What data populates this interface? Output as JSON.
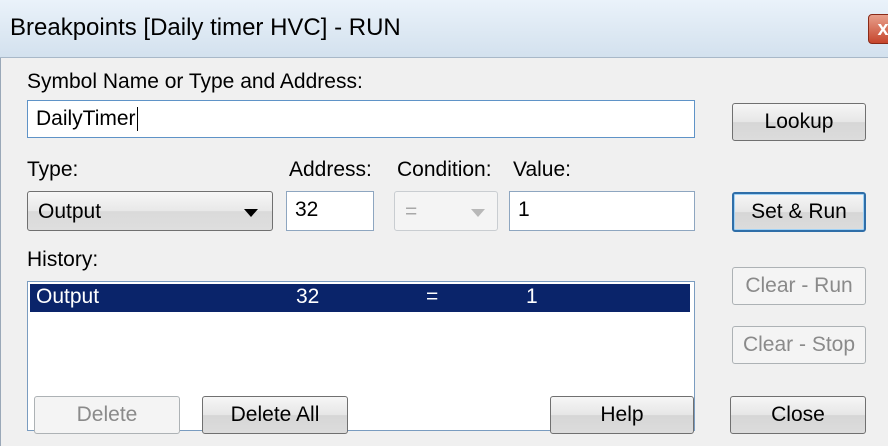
{
  "window": {
    "title": "Breakpoints [Daily timer HVC] - RUN",
    "close_glyph": "x"
  },
  "symbol": {
    "label": "Symbol Name or Type and Address:",
    "value": "DailyTimer"
  },
  "fields": {
    "type_label": "Type:",
    "type_value": "Output",
    "address_label": "Address:",
    "address_value": "32",
    "condition_label": "Condition:",
    "condition_value": "=",
    "value_label": "Value:",
    "value_value": "1"
  },
  "history": {
    "label": "History:",
    "rows": [
      {
        "type": "Output",
        "address": "32",
        "condition": "=",
        "value": "1"
      }
    ]
  },
  "buttons": {
    "lookup": "Lookup",
    "set_run": "Set & Run",
    "clear_run": "Clear - Run",
    "clear_stop": "Clear - Stop",
    "delete": "Delete",
    "delete_all": "Delete All",
    "help": "Help",
    "close": "Close"
  },
  "icons": {
    "dropdown": "chevron-down-icon",
    "close": "close-icon"
  },
  "colors": {
    "selection": "#0a246a",
    "default_button_border": "#2f6ea8"
  }
}
